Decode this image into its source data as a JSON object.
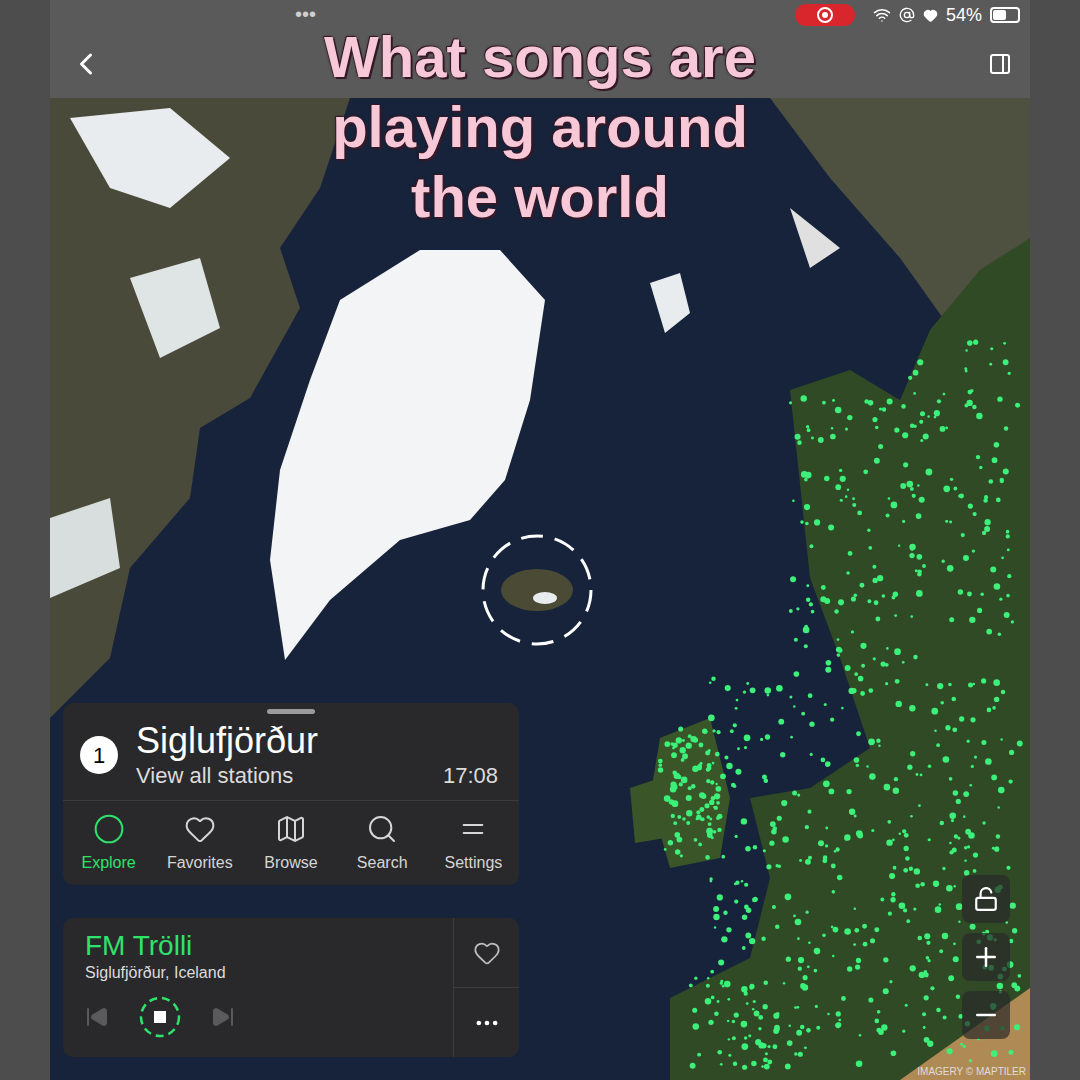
{
  "status_bar": {
    "dots": "•••",
    "battery": "54%",
    "battery_level": 0.54,
    "recording": true
  },
  "caption": "What songs are playing around the world",
  "place_card": {
    "count": "1",
    "place": "Siglufjörður",
    "link": "View all stations",
    "time": "17:08"
  },
  "nav": [
    {
      "label": "Explore",
      "selected": true
    },
    {
      "label": "Favorites",
      "selected": false
    },
    {
      "label": "Browse",
      "selected": false
    },
    {
      "label": "Search",
      "selected": false
    },
    {
      "label": "Settings",
      "selected": false
    }
  ],
  "player": {
    "station": "FM Trölli",
    "location": "Siglufjörður, Iceland",
    "playing": true,
    "favorite": false
  },
  "attribution": "IMAGERY © MAPTILER"
}
